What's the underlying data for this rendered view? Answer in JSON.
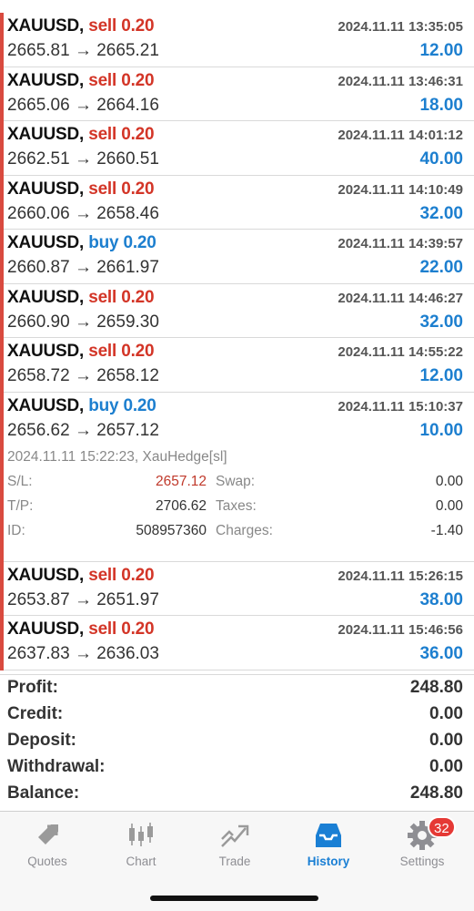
{
  "deals": [
    {
      "symbol": "XAUUSD,",
      "side": "sell",
      "volume": "0.20",
      "time": "2024.11.11 13:35:05",
      "prices": "2665.81 → 2665.21",
      "profit": "12.00"
    },
    {
      "symbol": "XAUUSD,",
      "side": "sell",
      "volume": "0.20",
      "time": "2024.11.11 13:46:31",
      "prices": "2665.06 → 2664.16",
      "profit": "18.00"
    },
    {
      "symbol": "XAUUSD,",
      "side": "sell",
      "volume": "0.20",
      "time": "2024.11.11 14:01:12",
      "prices": "2662.51 → 2660.51",
      "profit": "40.00"
    },
    {
      "symbol": "XAUUSD,",
      "side": "sell",
      "volume": "0.20",
      "time": "2024.11.11 14:10:49",
      "prices": "2660.06 → 2658.46",
      "profit": "32.00"
    },
    {
      "symbol": "XAUUSD,",
      "side": "buy",
      "volume": "0.20",
      "time": "2024.11.11 14:39:57",
      "prices": "2660.87 → 2661.97",
      "profit": "22.00"
    },
    {
      "symbol": "XAUUSD,",
      "side": "sell",
      "volume": "0.20",
      "time": "2024.11.11 14:46:27",
      "prices": "2660.90 → 2659.30",
      "profit": "32.00"
    },
    {
      "symbol": "XAUUSD,",
      "side": "sell",
      "volume": "0.20",
      "time": "2024.11.11 14:55:22",
      "prices": "2658.72 → 2658.12",
      "profit": "12.00"
    },
    {
      "symbol": "XAUUSD,",
      "side": "buy",
      "volume": "0.20",
      "time": "2024.11.11 15:10:37",
      "prices": "2656.62 → 2657.12",
      "profit": "10.00",
      "details": {
        "subtitle": "2024.11.11 15:22:23, XauHedge[sl]",
        "sl_label": "S/L:",
        "sl_value": "2657.12",
        "tp_label": "T/P:",
        "tp_value": "2706.62",
        "id_label": "ID:",
        "id_value": "508957360",
        "swap_label": "Swap:",
        "swap_value": "0.00",
        "taxes_label": "Taxes:",
        "taxes_value": "0.00",
        "charges_label": "Charges:",
        "charges_value": "-1.40"
      }
    },
    {
      "symbol": "XAUUSD,",
      "side": "sell",
      "volume": "0.20",
      "time": "2024.11.11 15:26:15",
      "prices": "2653.87 → 2651.97",
      "profit": "38.00"
    },
    {
      "symbol": "XAUUSD,",
      "side": "sell",
      "volume": "0.20",
      "time": "2024.11.11 15:46:56",
      "prices": "2637.83 → 2636.03",
      "profit": "36.00"
    }
  ],
  "summary": [
    {
      "label": "Profit:",
      "value": "248.80"
    },
    {
      "label": "Credit:",
      "value": "0.00"
    },
    {
      "label": "Deposit:",
      "value": "0.00"
    },
    {
      "label": "Withdrawal:",
      "value": "0.00"
    },
    {
      "label": "Balance:",
      "value": "248.80"
    }
  ],
  "tabs": [
    {
      "label": "Quotes",
      "icon": "quotes-icon"
    },
    {
      "label": "Chart",
      "icon": "chart-icon"
    },
    {
      "label": "Trade",
      "icon": "trade-icon"
    },
    {
      "label": "History",
      "icon": "history-icon",
      "active": true
    },
    {
      "label": "Settings",
      "icon": "settings-icon",
      "badge": "32"
    }
  ],
  "colors": {
    "sell": "#d33527",
    "buy": "#1d7fcf",
    "accent": "#1a7fd4",
    "badge": "#e53935"
  }
}
